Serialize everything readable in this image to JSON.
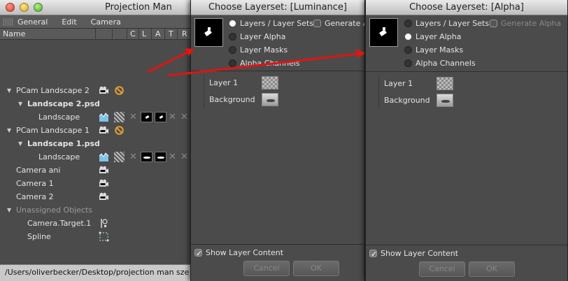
{
  "main_window": {
    "title": "Projection Man",
    "menu": [
      "General",
      "Edit",
      "Camera"
    ],
    "columns": {
      "name": "Name",
      "c": "C",
      "l": "L",
      "a": "A",
      "t": "T",
      "r": "R"
    },
    "tree": [
      {
        "label": "PCam Landscape 2",
        "icons": [
          "camera-icon",
          "disabled-icon"
        ]
      },
      {
        "label": "Landscape 2.psd"
      },
      {
        "label": "Landscape",
        "icons": [
          "projection-icon",
          "hatched-icon",
          "x-icon"
        ]
      },
      {
        "label": "PCam Landscape 1",
        "icons": [
          "camera-icon",
          "disabled-icon"
        ]
      },
      {
        "label": "Landscape 1.psd"
      },
      {
        "label": "Landscape",
        "icons": [
          "projection-icon",
          "hatched-icon",
          "x-icon"
        ]
      },
      {
        "label": "Camera ani",
        "icons": [
          "camera-icon"
        ]
      },
      {
        "label": "Camera 1",
        "icons": [
          "camera-icon"
        ]
      },
      {
        "label": "Camera 2",
        "icons": [
          "camera-icon"
        ]
      },
      {
        "label": "Unassigned Objects"
      },
      {
        "label": "Camera.Target.1",
        "icons": [
          "target-icon"
        ]
      },
      {
        "label": "Spline",
        "icons": [
          "spline-icon"
        ]
      }
    ],
    "status": "/Users/oliverbecker/Desktop/projection man sze"
  },
  "dialogs": [
    {
      "title": "Choose Layerset:  [Luminance]",
      "options": [
        "Layers / Layer Sets",
        "Layer Alpha",
        "Layer Masks",
        "Alpha Channels"
      ],
      "selected_option": "Layers / Layer Sets",
      "generate_label": "Generate A",
      "layers": [
        "Layer 1",
        "Background"
      ],
      "show_content_label": "Show Layer Content",
      "show_content_checked": true,
      "cancel_label": "Cancel",
      "ok_label": "OK"
    },
    {
      "title": "Choose Layerset:  [Alpha]",
      "options": [
        "Layers / Layer Sets",
        "Layer Alpha",
        "Layer Masks",
        "Alpha Channels"
      ],
      "selected_option": "Layer Alpha",
      "generate_label": "Generate Alpha",
      "layers": [
        "Layer 1",
        "Background"
      ],
      "show_content_label": "Show Layer Content",
      "show_content_checked": true,
      "cancel_label": "Cancel",
      "ok_label": "OK"
    }
  ],
  "colors": {
    "arrow": "#e01414",
    "window_bg": "#4b4b4b",
    "title_bg": "#d4d4d4",
    "status_bg": "#c9c9c9"
  }
}
